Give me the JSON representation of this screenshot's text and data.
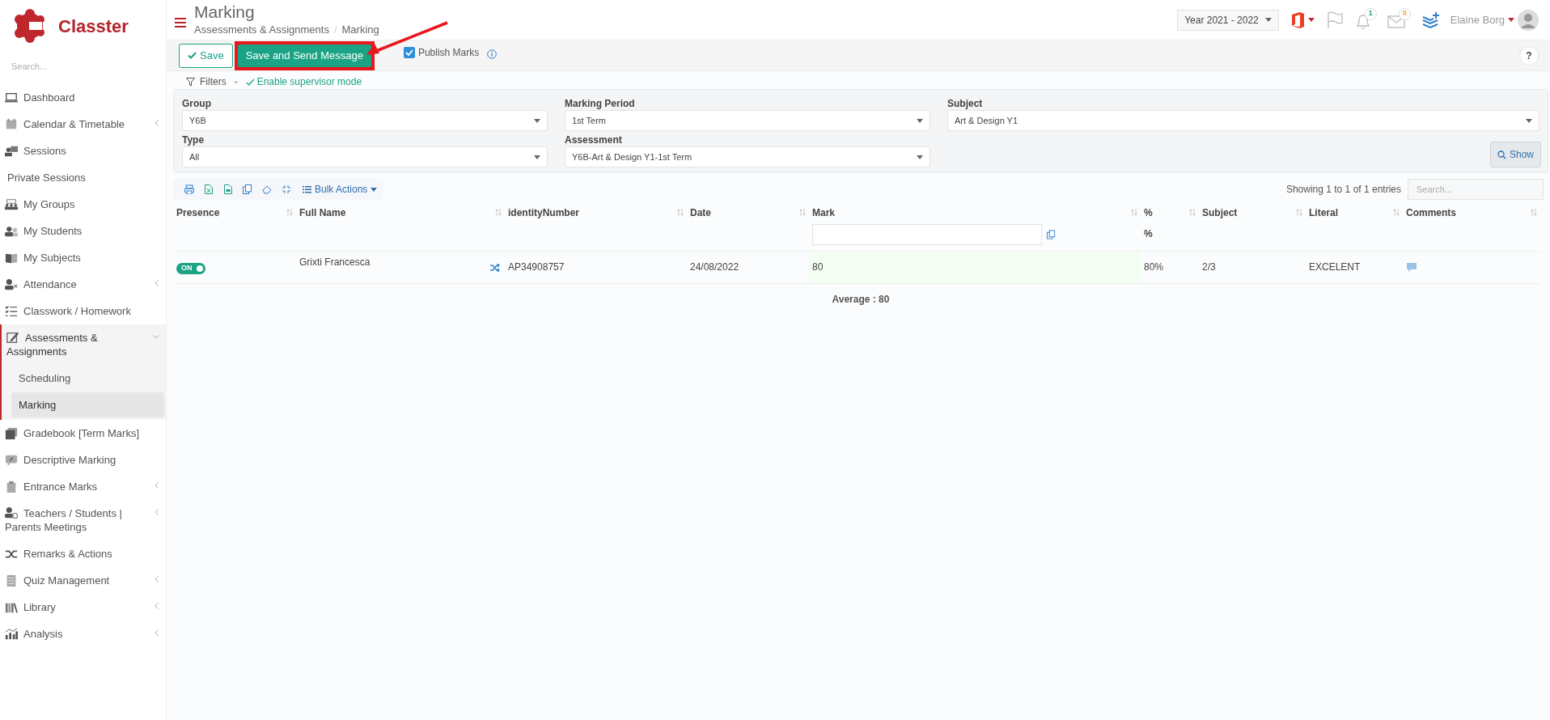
{
  "sidebar": {
    "brand": "Classter",
    "search": {
      "placeholder": "Search..."
    },
    "items": [
      {
        "label": "Dashboard",
        "has_submenu": false,
        "expanded": false,
        "selected": false
      },
      {
        "label": "Calendar & Timetable",
        "has_submenu": true,
        "expanded": false,
        "selected": false
      },
      {
        "label": "Sessions",
        "has_submenu": false,
        "expanded": false,
        "selected": false
      },
      {
        "label": "Private Sessions",
        "has_submenu": false,
        "expanded": false,
        "selected": false
      },
      {
        "label": "My Groups",
        "has_submenu": false,
        "expanded": false,
        "selected": false
      },
      {
        "label": "My Students",
        "has_submenu": false,
        "expanded": false,
        "selected": false
      },
      {
        "label": "My Subjects",
        "has_submenu": false,
        "expanded": false,
        "selected": false
      },
      {
        "label": "Attendance",
        "has_submenu": true,
        "expanded": false,
        "selected": false
      },
      {
        "label": "Classwork / Homework",
        "has_submenu": false,
        "expanded": false,
        "selected": false
      },
      {
        "label": "Assessments & Assignments",
        "has_submenu": true,
        "expanded": true,
        "selected": true,
        "children": [
          {
            "label": "Scheduling",
            "selected": false
          },
          {
            "label": "Marking",
            "selected": true
          }
        ]
      },
      {
        "label": "Gradebook [Term Marks]",
        "has_submenu": false,
        "expanded": false,
        "selected": false
      },
      {
        "label": "Descriptive Marking",
        "has_submenu": false,
        "expanded": false,
        "selected": false
      },
      {
        "label": "Entrance Marks",
        "has_submenu": true,
        "expanded": false,
        "selected": false
      },
      {
        "label": "Teachers / Students | Parents Meetings",
        "has_submenu": true,
        "expanded": false,
        "selected": false
      },
      {
        "label": "Remarks & Actions",
        "has_submenu": false,
        "expanded": false,
        "selected": false
      },
      {
        "label": "Quiz Management",
        "has_submenu": true,
        "expanded": false,
        "selected": false
      },
      {
        "label": "Library",
        "has_submenu": true,
        "expanded": false,
        "selected": false
      },
      {
        "label": "Analysis",
        "has_submenu": true,
        "expanded": false,
        "selected": false
      }
    ]
  },
  "header": {
    "title": "Marking",
    "breadcrumb": [
      "Assessments & Assignments",
      "Marking"
    ],
    "breadcrumb_separator": "/",
    "year": "Year 2021 - 2022",
    "notifications": "1",
    "messages": "0",
    "user": "Elaine Borg"
  },
  "toolbar": {
    "buttons": [
      {
        "label": "Save",
        "highlighted": false
      },
      {
        "label": "Save and Send Message",
        "highlighted": true
      }
    ],
    "publish": {
      "label": "Publish Marks",
      "checked": true
    },
    "help": "?"
  },
  "filters": {
    "label": "Filters",
    "separator": "-",
    "supervisor_link": "Enable supervisor mode",
    "fields": [
      {
        "label": "Group",
        "value": "Y6B"
      },
      {
        "label": "Marking Period",
        "value": "1st Term"
      },
      {
        "label": "Subject",
        "value": "Art & Design Y1"
      },
      {
        "label": "Type",
        "value": "All"
      },
      {
        "label": "Assessment",
        "value": "Y6B-Art & Design Y1-1st Term"
      }
    ],
    "show_button": "Show"
  },
  "table": {
    "bulk_actions": "Bulk Actions",
    "info": "Showing 1 to 1 of 1 entries",
    "search": {
      "placeholder": "Search..."
    },
    "columns": [
      "Presence",
      "Full Name",
      "identityNumber",
      "Date",
      "Mark",
      "%",
      "Subject",
      "Literal",
      "Comments"
    ],
    "percent_subheader": "%",
    "rows": [
      {
        "presence": {
          "label": "ON",
          "on": true
        },
        "full_name": "Grixti Francesca",
        "identity_number": "AP34908757",
        "date": "24/08/2022",
        "mark": "80",
        "percent": "80%",
        "subject": "2/3",
        "literal": "EXCELENT"
      }
    ],
    "average": "Average : 80"
  }
}
